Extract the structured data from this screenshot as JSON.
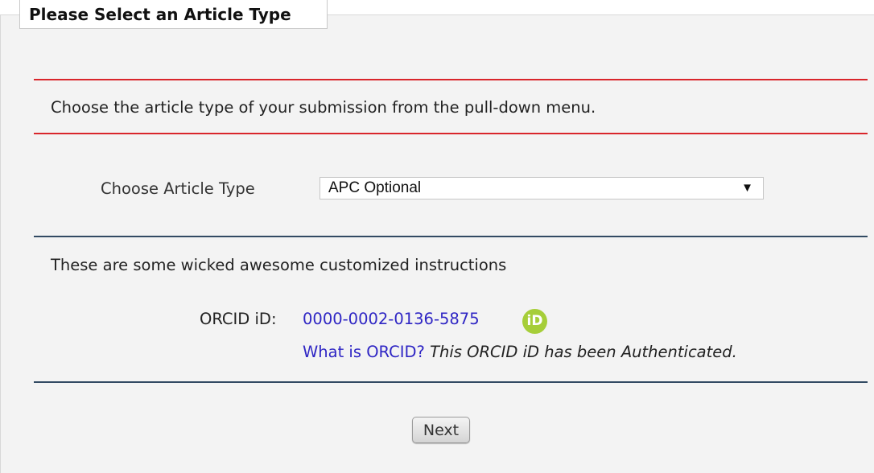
{
  "panel": {
    "title": "Please Select an Article Type",
    "intro_text": "Choose the article type of your submission from the pull-down menu."
  },
  "article_type": {
    "label": "Choose Article Type",
    "selected_value": "APC Optional",
    "arrow_glyph": "▼"
  },
  "instructions": {
    "text": "These are some wicked awesome customized instructions"
  },
  "orcid": {
    "label": "ORCID iD:",
    "id_value": "0000-0002-0136-5875",
    "logo_text": "iD",
    "logo_color": "#a6ce39",
    "what_is_link": "What is ORCID?",
    "auth_status": "This ORCID iD has been Authenticated."
  },
  "actions": {
    "next_label": "Next"
  },
  "colors": {
    "rule_red": "#d9262b",
    "rule_navy": "#324a63",
    "link_blue": "#2f26c4",
    "panel_bg": "#f3f3f3"
  }
}
